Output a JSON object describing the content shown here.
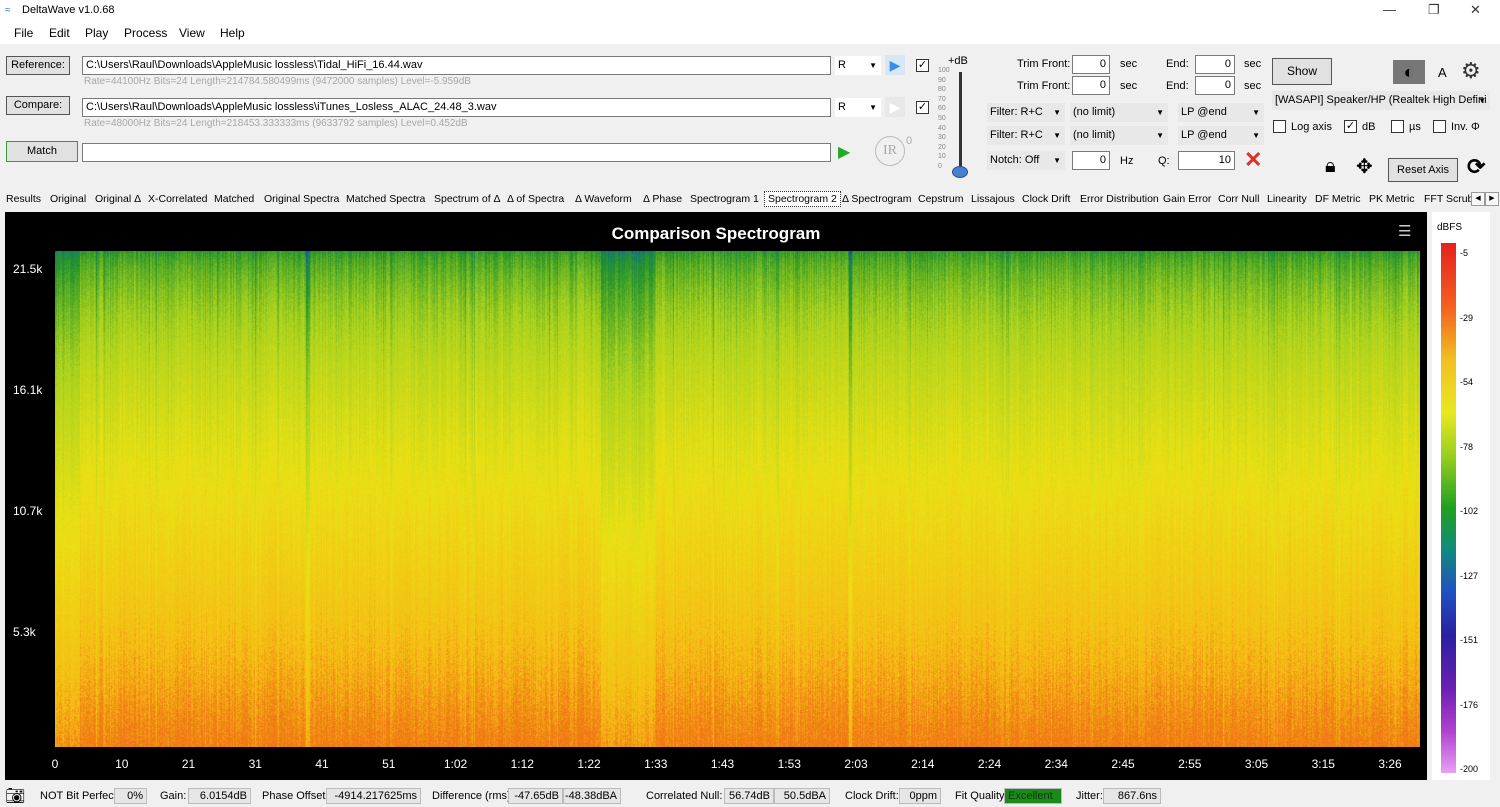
{
  "window": {
    "title": "DeltaWave v1.0.68"
  },
  "menu": [
    "File",
    "Edit",
    "Play",
    "Process",
    "View",
    "Help"
  ],
  "reference": {
    "button": "Reference:",
    "path": "C:\\Users\\Raul\\Downloads\\AppleMusic lossless\\Tidal_HiFi_16.44.wav",
    "info": "Rate=44100Hz Bits=24 Length=214784.580499ms (9472000 samples) Level=-5.959dB",
    "channel": "R",
    "checked": true
  },
  "compare": {
    "button": "Compare:",
    "path": "C:\\Users\\Raul\\Downloads\\AppleMusic lossless\\iTunes_Losless_ALAC_24.48_3.wav",
    "info": "Rate=48000Hz Bits=24 Length=218453.333333ms (9633792 samples) Level=0.452dB",
    "channel": "R",
    "checked": true
  },
  "match": {
    "button": "Match",
    "progress": ""
  },
  "level_slider": {
    "label": "+dB",
    "ticks": [
      "100",
      "90",
      "80",
      "70",
      "60",
      "50",
      "40",
      "30",
      "20",
      "10",
      "0"
    ],
    "value": 0
  },
  "trim": [
    {
      "front_label": "Trim Front:",
      "front": "0",
      "unit": "sec",
      "end_label": "End:",
      "end": "0",
      "end_unit": "sec"
    },
    {
      "front_label": "Trim Front:",
      "front": "0",
      "unit": "sec",
      "end_label": "End:",
      "end": "0",
      "end_unit": "sec"
    }
  ],
  "filters": [
    {
      "filter": "Filter: R+C",
      "limit": "(no limit)",
      "lp": "LP @end"
    },
    {
      "filter": "Filter: R+C",
      "limit": "(no limit)",
      "lp": "LP @end"
    }
  ],
  "notch": {
    "mode": "Notch: Off",
    "freq": "0",
    "unit": "Hz",
    "q_label": "Q:",
    "q": "10"
  },
  "right": {
    "show": "Show",
    "font_label": "A",
    "device": "[WASAPI] Speaker/HP (Realtek High Defini",
    "log_axis": {
      "label": "Log axis",
      "checked": false
    },
    "db": {
      "label": "dB",
      "checked": true
    },
    "us": {
      "label": "µs",
      "checked": false
    },
    "inv": {
      "label": "Inv. Φ",
      "checked": false
    },
    "reset_axis": "Reset Axis"
  },
  "tabs": [
    "Results",
    "Original",
    "Original Δ",
    "X-Correlated",
    "Matched",
    "Original Spectra",
    "Matched Spectra",
    "Spectrum of Δ",
    "Δ of Spectra",
    "Δ Waveform",
    "Δ Phase",
    "Spectrogram 1",
    "Spectrogram 2",
    "Δ Spectrogram",
    "Cepstrum",
    "Lissajous",
    "Clock Drift",
    "Error Distribution",
    "Gain Error",
    "Corr Null",
    "Linearity",
    "DF Metric",
    "PK Metric",
    "FFT Scrub"
  ],
  "active_tab": "Spectrogram 2",
  "plot": {
    "title": "Comparison Spectrogram",
    "y_ticks": [
      "21.5k",
      "16.1k",
      "10.7k",
      "5.3k"
    ],
    "x_ticks": [
      "0",
      "10",
      "21",
      "31",
      "41",
      "51",
      "1:02",
      "1:12",
      "1:22",
      "1:33",
      "1:43",
      "1:53",
      "2:03",
      "2:14",
      "2:24",
      "2:34",
      "2:45",
      "2:55",
      "3:05",
      "3:15",
      "3:26"
    ],
    "colorbar": {
      "label": "dBFS",
      "ticks": [
        "-5",
        "-29",
        "-54",
        "-78",
        "-102",
        "-127",
        "-151",
        "-176",
        "-200"
      ]
    }
  },
  "status": {
    "bit_perfect_label": "NOT Bit Perfect",
    "bit_perfect": "0%",
    "gain_label": "Gain:",
    "gain": "6.0154dB",
    "phase_label": "Phase Offset:",
    "phase": "-4914.217625ms",
    "diff_label": "Difference (rms):",
    "diff_db": "-47.65dB",
    "diff_dba": "-48.38dBA",
    "null_label": "Correlated Null:",
    "null_db": "56.74dB",
    "null_dba": "50.5dBA",
    "drift_label": "Clock Drift:",
    "drift": "0ppm",
    "fit_label": "Fit Quality:",
    "fit": "Excellent",
    "jitter_label": "Jitter:",
    "jitter": "867.6ns"
  },
  "colors": {
    "fit_good": "#1a8a1a",
    "notch_clear": "#d9302c",
    "play": "#3a8ee6",
    "match_play": "#22aa22"
  }
}
